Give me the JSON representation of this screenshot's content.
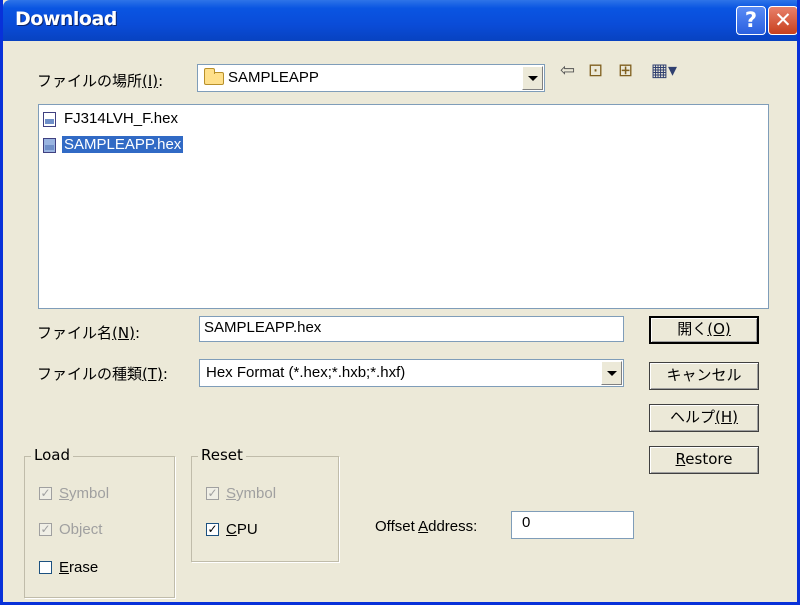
{
  "window": {
    "title": "Download"
  },
  "location": {
    "label_text": "ファイルの場所",
    "label_key": "(I)",
    "folder": "SAMPLEAPP"
  },
  "files": [
    {
      "name": "FJ314LVH_F.hex",
      "selected": false
    },
    {
      "name": "SAMPLEAPP.hex",
      "selected": true
    }
  ],
  "filename": {
    "label_text": "ファイル名",
    "label_key": "(N)",
    "suffix": ":",
    "value": "SAMPLEAPP.hex"
  },
  "filetype": {
    "label_text": "ファイルの種類",
    "label_key": "(T)",
    "suffix": ":",
    "value": "Hex Format (*.hex;*.hxb;*.hxf)"
  },
  "buttons": {
    "open": {
      "text": "開く",
      "key": "(O)"
    },
    "cancel": "キャンセル",
    "help": {
      "text": "ヘルプ",
      "key": "(H)"
    },
    "restore": {
      "key": "R",
      "rest": "estore"
    }
  },
  "load_group": {
    "title": "Load",
    "symbol": {
      "key": "S",
      "rest": "ymbol",
      "checked": true,
      "disabled": true
    },
    "object": {
      "pre": "Ob",
      "key": "j",
      "rest": "ect",
      "checked": true,
      "disabled": true
    },
    "erase": {
      "key": "E",
      "rest": "rase",
      "checked": false,
      "disabled": false
    }
  },
  "reset_group": {
    "title": "Reset",
    "symbol": {
      "key": "S",
      "rest": "ymbol",
      "checked": true,
      "disabled": true
    },
    "cpu": {
      "key": "C",
      "rest": "PU",
      "checked": true,
      "disabled": false
    }
  },
  "offset": {
    "pre": "Offset ",
    "key": "A",
    "rest": "ddress:",
    "value": "0"
  },
  "colors": {
    "titlebar": "#0A55E2",
    "dialog": "#ECE9D8",
    "selection": "#316AC5"
  }
}
